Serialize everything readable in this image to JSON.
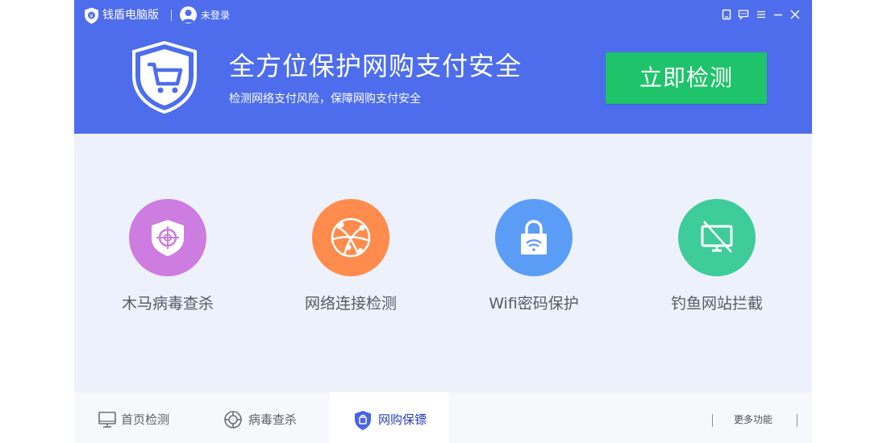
{
  "app": {
    "name": "钱盾电脑版",
    "login_status": "未登录",
    "header_color": "#4d6ded"
  },
  "window_controls": [
    {
      "name": "skin-icon"
    },
    {
      "name": "feedback-icon"
    },
    {
      "name": "menu-icon"
    },
    {
      "name": "minimize-icon"
    },
    {
      "name": "close-icon"
    }
  ],
  "hero": {
    "title": "全方位保护网购支付安全",
    "subtitle": "检测网络支付风险，保障网购支付安全",
    "action_label": "立即检测",
    "action_color": "#1fc46a"
  },
  "features": [
    {
      "label": "木马病毒查杀",
      "icon": "trojan-shield-icon",
      "color": "#cd7ce0"
    },
    {
      "label": "网络连接检测",
      "icon": "network-globe-icon",
      "color": "#ff8c4c"
    },
    {
      "label": "Wifi密码保护",
      "icon": "wifi-lock-icon",
      "color": "#5b9cf6"
    },
    {
      "label": "钓鱼网站拦截",
      "icon": "phishing-block-icon",
      "color": "#3ecc9a"
    }
  ],
  "bottom_nav": {
    "tabs": [
      {
        "label": "首页检测",
        "icon": "monitor-icon",
        "active": false
      },
      {
        "label": "病毒查杀",
        "icon": "crosshair-icon",
        "active": false
      },
      {
        "label": "网购保镖",
        "icon": "shopping-shield-icon",
        "active": true
      }
    ],
    "more_label": "更多功能"
  }
}
